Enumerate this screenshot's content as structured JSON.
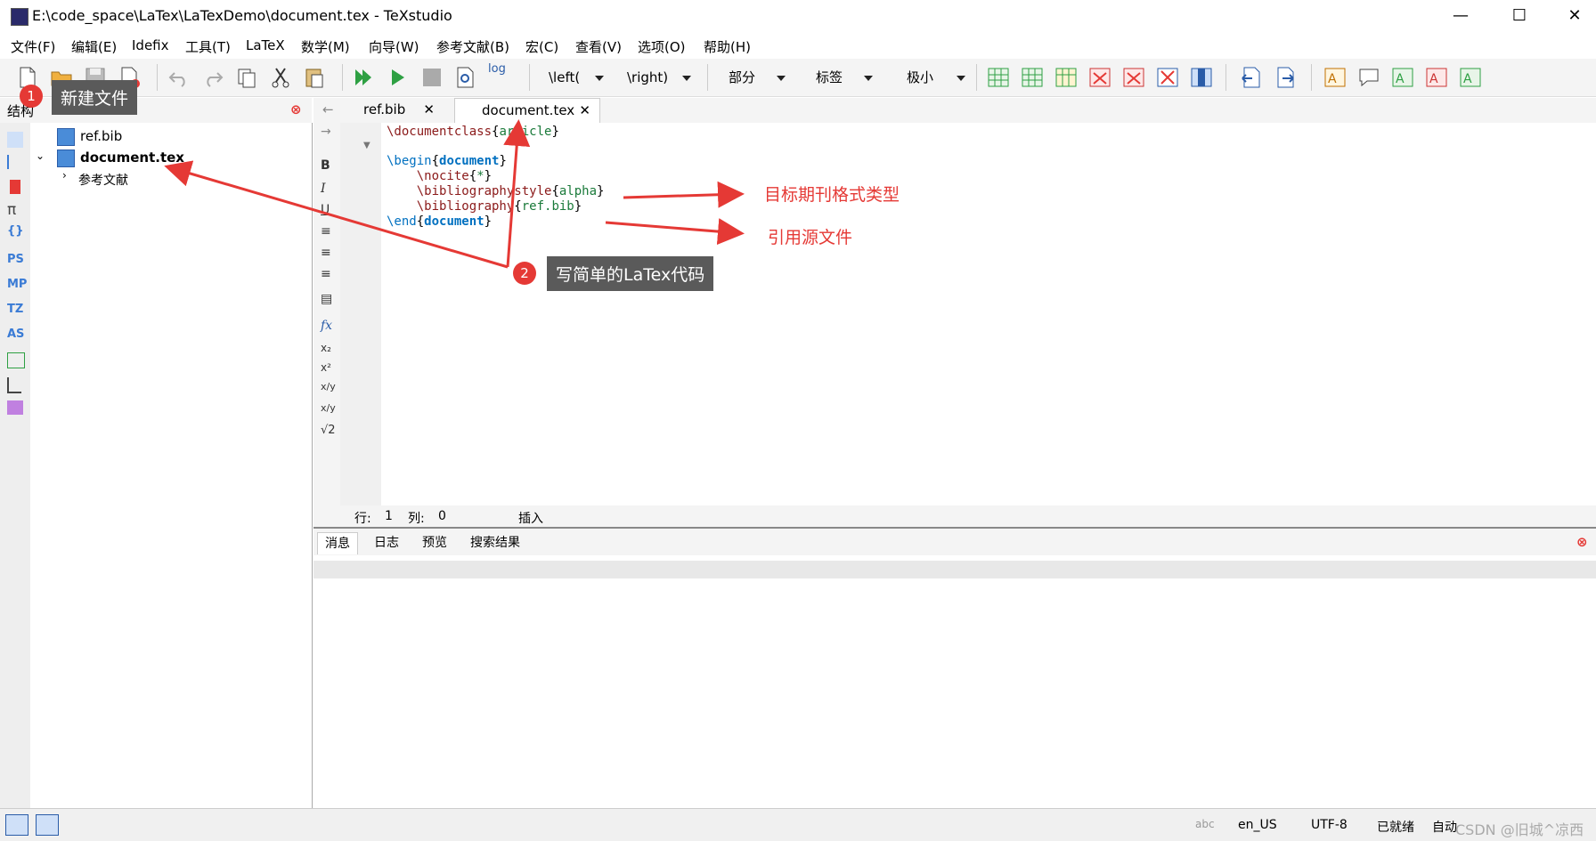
{
  "window": {
    "title": "E:\\code_space\\LaTex\\LaTexDemo\\document.tex - TeXstudio",
    "minimize": "—",
    "maximize": "☐",
    "close": "✕"
  },
  "menu": [
    "文件(F)",
    "编辑(E)",
    "Idefix",
    "工具(T)",
    "LaTeX",
    "数学(M)",
    "向导(W)",
    "参考文献(B)",
    "宏(C)",
    "查看(V)",
    "选项(O)",
    "帮助(H)"
  ],
  "toolbar": {
    "left_combo": "\\left(",
    "right_combo": "\\right)",
    "section_combo": "部分",
    "label_combo": "标签",
    "size_combo": "极小",
    "log_label": "log"
  },
  "structure_panel": {
    "title": "结构",
    "tree": [
      {
        "label": "ref.bib"
      },
      {
        "label": "document.tex"
      },
      {
        "label": "参考文献"
      }
    ],
    "strip_labels": [
      "PS",
      "MP",
      "TZ",
      "AS"
    ]
  },
  "editor": {
    "tabs": [
      {
        "label": "ref.bib"
      },
      {
        "label": "document.tex"
      }
    ],
    "lines": [
      {
        "cmd": "\\documentclass",
        "arg": "article"
      },
      {
        "text": ""
      },
      {
        "cmd": "\\begin",
        "arg": "document"
      },
      {
        "cmd": "    \\nocite",
        "arg": "*"
      },
      {
        "cmd": "    \\bibliographystyle",
        "arg": "alpha"
      },
      {
        "cmd": "    \\bibliography",
        "arg": "ref.bib"
      },
      {
        "cmd": "\\end",
        "arg": "document"
      }
    ],
    "status": {
      "row_label": "行:",
      "row": "1",
      "col_label": "列:",
      "col": "0",
      "mode": "插入"
    }
  },
  "bottom_panel": {
    "tabs": [
      "消息",
      "日志",
      "预览",
      "搜索结果"
    ]
  },
  "status_bar": {
    "spell": "abc",
    "language": "en_US",
    "encoding": "UTF-8",
    "state": "已就绪",
    "auto": "自动",
    "watermark": "CSDN @旧城^凉西"
  },
  "annotations": {
    "callout1_num": "1",
    "callout1_text": "新建文件",
    "callout2_num": "2",
    "callout2_text": "写简单的LaTex代码",
    "note_style": "目标期刊格式类型",
    "note_source": "引用源文件"
  },
  "colors": {
    "accent_red": "#e53935",
    "callout_bg": "#5a5a5a",
    "keyword_blue": "#0070c0"
  }
}
